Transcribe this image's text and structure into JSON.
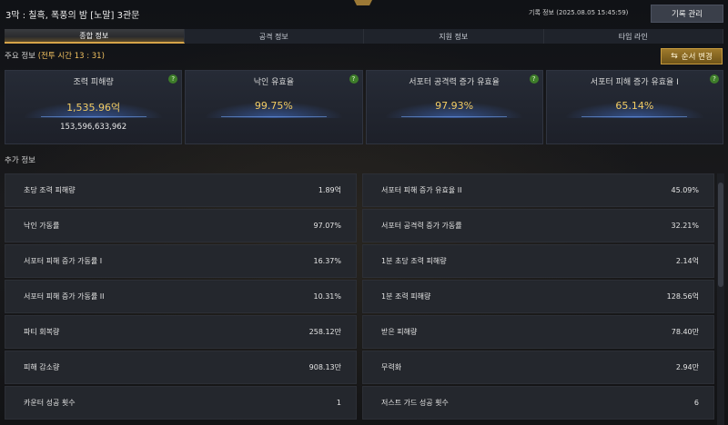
{
  "header": {
    "title": "3막 : 칠흑, 폭풍의 밤 [노말]  3관문",
    "record_time": "기록 정보 (2025.08.05 15:45:59)",
    "record_button": "기록 관리"
  },
  "tabs": [
    {
      "label": "종합 정보",
      "active": true
    },
    {
      "label": "공격 정보",
      "active": false
    },
    {
      "label": "지원 정보",
      "active": false
    },
    {
      "label": "타임 라인",
      "active": false
    }
  ],
  "main_info": {
    "label": "주요 정보",
    "battle_time": "(전투 시간 13 : 31)",
    "order_button": "순서 변경"
  },
  "cards": [
    {
      "title": "조력 피해량",
      "value": "1,535.96억",
      "sub": "153,596,633,962"
    },
    {
      "title": "낙인 유효율",
      "value": "99.75%",
      "sub": ""
    },
    {
      "title": "서포터 공격력 증가 유효율",
      "value": "97.93%",
      "sub": ""
    },
    {
      "title": "서포터 피해 증가 유효율 I",
      "value": "65.14%",
      "sub": ""
    }
  ],
  "help_label": "?",
  "extra_info": {
    "label": "추가 정보",
    "rows": [
      [
        {
          "label": "초당 조력 피해량",
          "value": "1.89억"
        },
        {
          "label": "서포터 피해 증가 유효율 II",
          "value": "45.09%"
        }
      ],
      [
        {
          "label": "낙인 가동률",
          "value": "97.07%"
        },
        {
          "label": "서포터 공격력 증가 가동률",
          "value": "32.21%"
        }
      ],
      [
        {
          "label": "서포터 피해 증가 가동률 I",
          "value": "16.37%"
        },
        {
          "label": "1분 초당 조력 피해량",
          "value": "2.14억"
        }
      ],
      [
        {
          "label": "서포터 피해 증가 가동률 II",
          "value": "10.31%"
        },
        {
          "label": "1분 조력 피해량",
          "value": "128.56억"
        }
      ],
      [
        {
          "label": "파티 회복량",
          "value": "258.12만"
        },
        {
          "label": "받은 피해량",
          "value": "78.40만"
        }
      ],
      [
        {
          "label": "피해 감소량",
          "value": "908.13만"
        },
        {
          "label": "무력화",
          "value": "2.94만"
        }
      ],
      [
        {
          "label": "카운터 성공 횟수",
          "value": "1"
        },
        {
          "label": "저스트 가드 성공 횟수",
          "value": "6"
        }
      ]
    ]
  },
  "colors": {
    "accent_gold": "#f3cc63",
    "tab_active_border": "#d6a449",
    "help_green": "#3e7d2a"
  }
}
